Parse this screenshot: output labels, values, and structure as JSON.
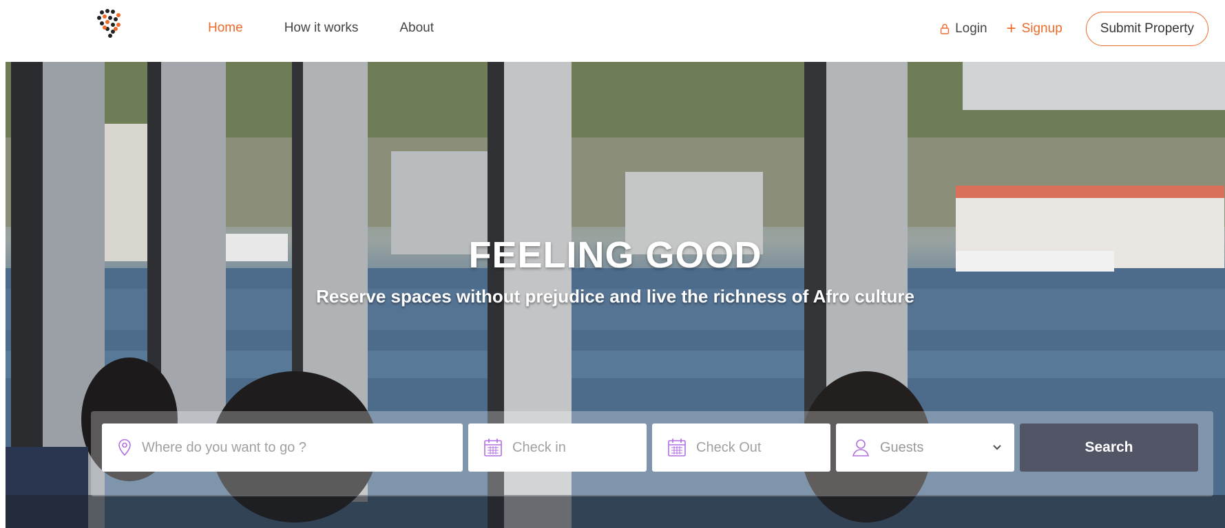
{
  "nav": {
    "items": [
      {
        "label": "Home",
        "active": true
      },
      {
        "label": "How it works",
        "active": false
      },
      {
        "label": "About",
        "active": false
      }
    ],
    "login": "Login",
    "signup": "Signup",
    "submit": "Submit Property"
  },
  "hero": {
    "title": "FEELING GOOD",
    "subtitle": "Reserve spaces without prejudice and live the richness of Afro culture"
  },
  "search": {
    "where_placeholder": "Where do you want to go ?",
    "checkin_placeholder": "Check in",
    "checkout_placeholder": "Check Out",
    "guests_label": "Guests",
    "button": "Search"
  },
  "colors": {
    "accent": "#ee6a2a",
    "icon_purple": "#b06ee0",
    "search_button": "#525566"
  },
  "icons": [
    "logo-icon",
    "lock-icon",
    "plus-icon",
    "location-pin-icon",
    "calendar-icon",
    "user-icon",
    "chevron-down-icon"
  ]
}
